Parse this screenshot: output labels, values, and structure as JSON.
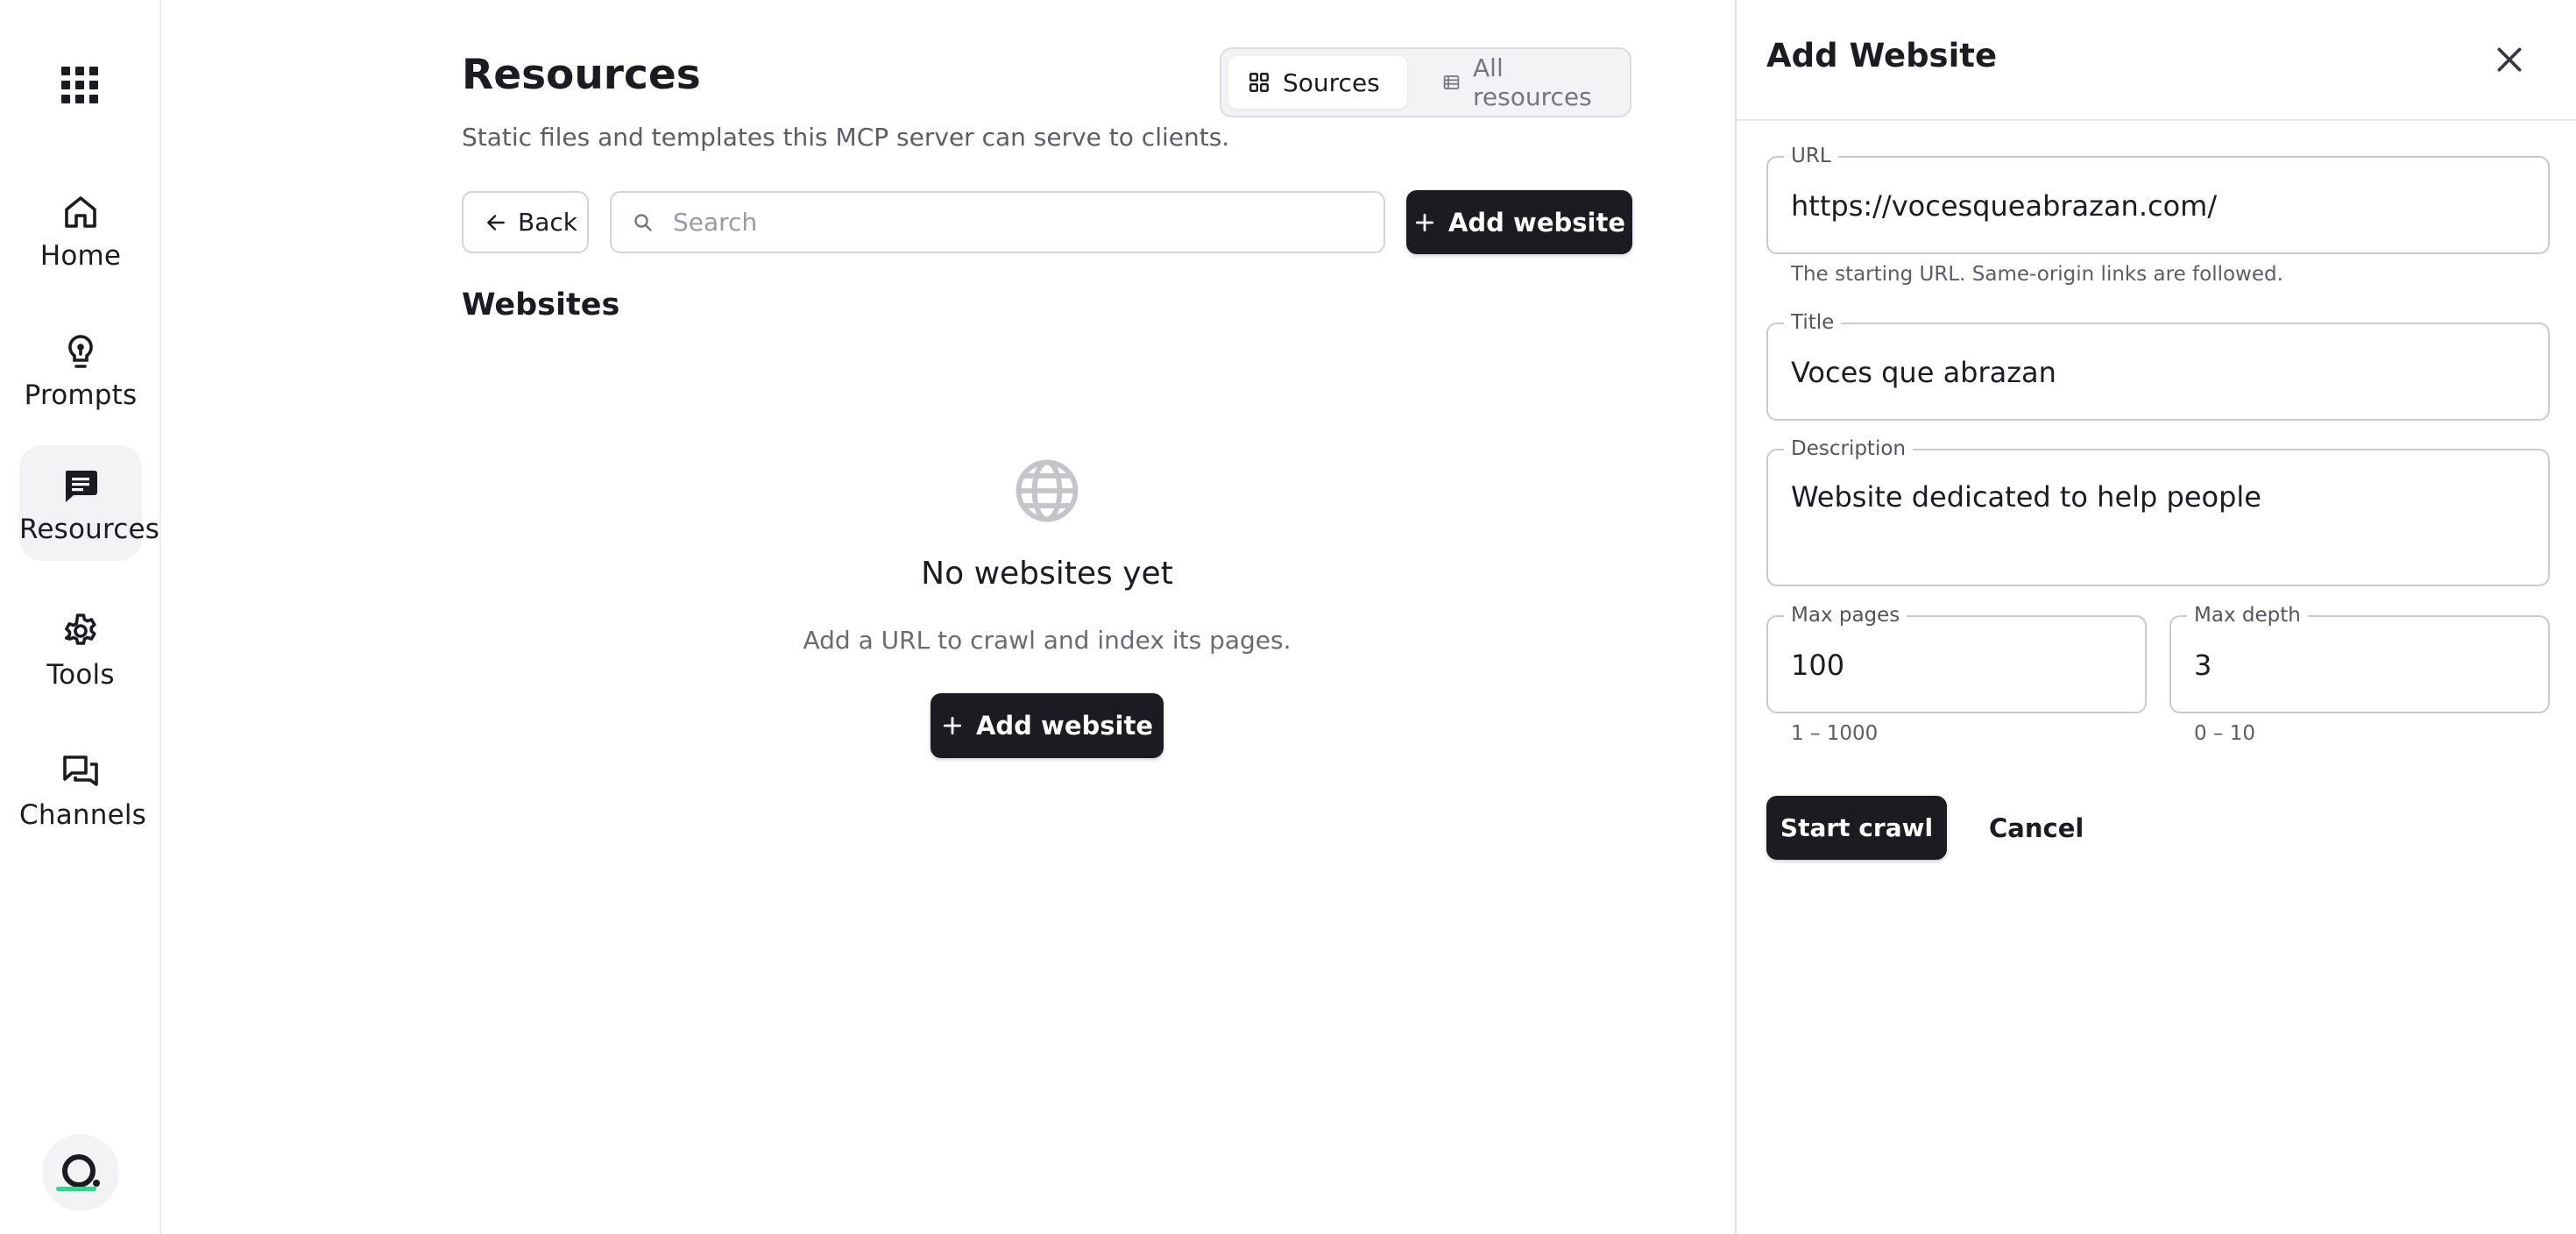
{
  "nav": {
    "items": [
      {
        "label": "Home",
        "icon": "home-icon"
      },
      {
        "label": "Prompts",
        "icon": "lightbulb-icon"
      },
      {
        "label": "Resources",
        "icon": "message-square-icon",
        "active": true
      },
      {
        "label": "Tools",
        "icon": "gear-icon"
      },
      {
        "label": "Channels",
        "icon": "chat-bubbles-icon"
      }
    ]
  },
  "main": {
    "title": "Resources",
    "subtitle": "Static files and templates this MCP server can serve to clients.",
    "view_toggle": {
      "sources": "Sources",
      "all_resources": "All resources",
      "selected": "Sources"
    },
    "back_label": "Back",
    "search_placeholder": "Search",
    "add_website_label": "Add website",
    "section_title": "Websites",
    "empty": {
      "title": "No websites yet",
      "subtitle": "Add a URL to crawl and index its pages.",
      "button": "Add website"
    }
  },
  "panel": {
    "title": "Add Website",
    "url": {
      "label": "URL",
      "value": "https://vocesqueabrazan.com/",
      "helper": "The starting URL. Same-origin links are followed."
    },
    "title_field": {
      "label": "Title",
      "value": "Voces que abrazan"
    },
    "description": {
      "label": "Description",
      "value": "Website dedicated to help people"
    },
    "max_pages": {
      "label": "Max pages",
      "value": "100",
      "helper": "1 – 1000"
    },
    "max_depth": {
      "label": "Max depth",
      "value": "3",
      "helper": "0 – 10"
    },
    "start_label": "Start crawl",
    "cancel_label": "Cancel"
  },
  "colors": {
    "primary": "#1c1b22",
    "muted": "#5d5c66",
    "border": "#c9c9cf",
    "active_bg": "#f3f3f5",
    "brand_accent": "#3ecf8e"
  }
}
